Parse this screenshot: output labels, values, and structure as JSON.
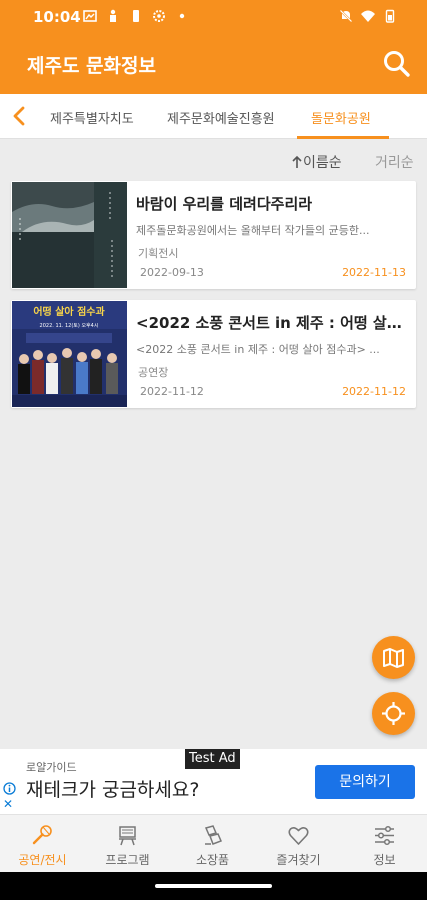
{
  "status": {
    "time": "10:04",
    "left_icons": [
      "gallery-icon",
      "person-icon",
      "battery-icon",
      "settings-icon",
      "dot-icon"
    ],
    "right_icons": [
      "mute-icon",
      "wifi-icon",
      "battery-icon"
    ]
  },
  "app": {
    "title": "제주도 문화정보",
    "accent_color": "#f7901e"
  },
  "tabs": {
    "items": [
      {
        "label": "제주특별자치도"
      },
      {
        "label": "제주문화예술진흥원"
      },
      {
        "label": "돌문화공원"
      }
    ],
    "active_index": 2
  },
  "sort": {
    "name_label": "이름순",
    "distance_label": "거리순"
  },
  "list": [
    {
      "title": "바람이 우리를 데려다주리라",
      "description": "제주돌문화공원에서는 올해부터 작가들의 균등한...",
      "category": "기획전시",
      "start_date": "2022-09-13",
      "end_date": "2022-11-13"
    },
    {
      "title": "<2022 소풍 콘서트 in 제주 : 어떵 살아...",
      "description": "<2022 소풍 콘서트 in 제주 : 어떵 살아 점수과> ...",
      "category": "공연장",
      "start_date": "2022-11-12",
      "end_date": "2022-11-12",
      "poster_text": "어떵 살아 점수과",
      "poster_subtext": "2022. 11. 12(토) 오후4시"
    }
  ],
  "ad": {
    "badge": "Test Ad",
    "advertiser": "로얄가이드",
    "headline": "재테크가 궁금하세요?",
    "cta": "문의하기"
  },
  "bottom_nav": [
    {
      "label": "공연/전시",
      "icon": "microphone-icon"
    },
    {
      "label": "프로그램",
      "icon": "program-icon"
    },
    {
      "label": "소장품",
      "icon": "collection-icon"
    },
    {
      "label": "즐겨찾기",
      "icon": "heart-icon"
    },
    {
      "label": "정보",
      "icon": "info-sliders-icon"
    }
  ]
}
